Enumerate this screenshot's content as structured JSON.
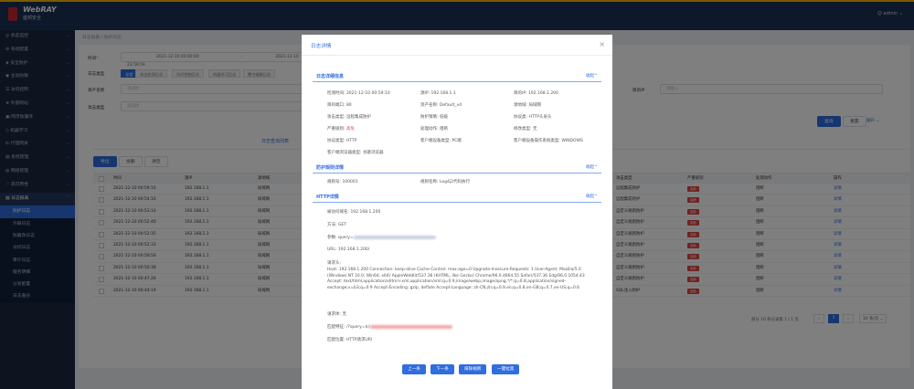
{
  "brand": {
    "name": "WebRAY",
    "sub": "盛邦安全"
  },
  "user": {
    "label": "admin"
  },
  "colors": {
    "accent": "#2f6de0",
    "danger": "#e0443e",
    "topbar": "#1b3157",
    "sidebar": "#1b2940"
  },
  "sidebar": {
    "items": [
      "状态监控",
      "系统配置",
      "安全防护",
      "主动防御",
      "访问控制",
      "外部网站",
      "网页防篡改",
      "机器学习",
      "代理网关",
      "系统管理",
      "网络管理",
      "高可用性",
      "日志报表"
    ],
    "sub": [
      "防护日志",
      "外联日志",
      "防篡改日志",
      "访问日志",
      "审计日志",
      "服务明细",
      "分发配置",
      "日志备份"
    ]
  },
  "breadcrumb": {
    "a": "日志报表",
    "sep": "/",
    "b": "防护日志"
  },
  "filters": {
    "time_label": "时间",
    "time_req": "*",
    "start": "2021-12-10 00:00:00",
    "to": "-",
    "end": "2021-12-10 23:59:59",
    "type_label": "日志类型",
    "chips": [
      "全部",
      "攻击检测日志",
      "访问控制日志",
      "机器学习日志",
      "暴力破解日志"
    ],
    "site_label": "资产名称",
    "site_ph": "请选择",
    "attack_label": "攻击类型",
    "attack_ph": "请选择",
    "ip_label": "目的IP",
    "ip_ph": "请输入",
    "query": "查询",
    "reset": "重置",
    "expand": "展开"
  },
  "table": {
    "tab": "日志查询列表",
    "actions": [
      "导出",
      "批删",
      "清空"
    ],
    "headers": [
      "时间",
      "源IP",
      "源地域",
      "攻击类型",
      "严重级别",
      "处理动作",
      "操作"
    ],
    "rows": [
      {
        "time": "2021-12-10 00:59:10",
        "ip": "192.168.1.1",
        "region": "局域网",
        "type": "远程集成防护",
        "sev": "高危",
        "act": "阻断",
        "op": "详情"
      },
      {
        "time": "2021-12-10 00:54:10",
        "ip": "192.168.1.1",
        "region": "局域网",
        "type": "远程集成防护",
        "sev": "高危",
        "act": "阻断",
        "op": "详情"
      },
      {
        "time": "2021-12-10 00:53:10",
        "ip": "192.168.1.1",
        "region": "局域网",
        "type": "自定义规则防护",
        "sev": "高危",
        "act": "阻断",
        "op": "详情"
      },
      {
        "time": "2021-12-10 00:52:40",
        "ip": "192.168.1.1",
        "region": "局域网",
        "type": "自定义规则防护",
        "sev": "高危",
        "act": "阻断",
        "op": "详情"
      },
      {
        "time": "2021-12-10 00:52:35",
        "ip": "192.168.1.1",
        "region": "局域网",
        "type": "自定义规则防护",
        "sev": "高危",
        "act": "阻断",
        "op": "详情"
      },
      {
        "time": "2021-12-10 00:52:33",
        "ip": "192.168.1.1",
        "region": "局域网",
        "type": "自定义规则防护",
        "sev": "高危",
        "act": "阻断",
        "op": "详情"
      },
      {
        "time": "2021-12-10 00:50:50",
        "ip": "192.168.1.1",
        "region": "局域网",
        "type": "自定义规则防护",
        "sev": "高危",
        "act": "阻断",
        "op": "详情"
      },
      {
        "time": "2021-12-10 00:50:38",
        "ip": "192.168.1.1",
        "region": "局域网",
        "type": "自定义规则防护",
        "sev": "高危",
        "act": "阻断",
        "op": "详情"
      },
      {
        "time": "2021-12-10 00:47:26",
        "ip": "192.168.1.1",
        "region": "局域网",
        "type": "自定义规则防护",
        "sev": "高危",
        "act": "阻断",
        "op": "详情"
      },
      {
        "time": "2021-12-10 00:44:19",
        "ip": "192.168.1.1",
        "region": "局域网",
        "type": "SQL注入防护",
        "sev": "高危",
        "act": "阻断",
        "op": "详情"
      }
    ],
    "pager": {
      "summary": "部分 10 条记录第 1 / 1 页",
      "page": "1",
      "size": "10 条/页"
    }
  },
  "modal": {
    "title": "日志详情",
    "collapse": "收起",
    "sec1": "日志详细信息",
    "f": {
      "time": "检测时间: 2021-12-10 00:59:10",
      "srcip": "源IP: 192.168.1.1",
      "dstip": "目的IP: 192.168.1.200",
      "dstport": "目的端口: 80",
      "asset": "资产名称: Default_v4",
      "region": "源地域: 局域网",
      "atype": "攻击类型: 远程集成防护",
      "chan": "防护策略: 低级",
      "proto": "协议类: HTTP头泉头",
      "sev_k": "严重级别:",
      "sev_v": "高危",
      "act": "处理动作: 阻断",
      "modtype": "修改类型: 无",
      "proto2": "协议类型: HTTP",
      "cli": "客户端设备类型: PC端",
      "os": "客户端设备操作系统类型: WINDOWS",
      "browser": "客户端浏览器类型: 谷歌浏览器"
    },
    "sec2": "防护规则详情",
    "rule_id": "规则号: 100001",
    "rule_name": "规则名称: Log4j2代码执行",
    "sec3": "HTTP详情",
    "host": "被访问域名: 192.168.1.200",
    "method": "方法: GET",
    "param_k": "参数:",
    "param_v": "query=",
    "url": "URL: 192.168.1.200/",
    "hdr_k": "请求头:",
    "hdr_v": "Host: 192.168.1.200 Connection: keep-alive Cache-Control: max-age=0 Upgrade-Insecure-Requests: 1 User-Agent: Mozilla/5.0 (Windows NT 10.0; Win64; x64) AppleWebKit/537.36 (KHTML, like Gecko) Chrome/96.0.4664.55 Safari/537.36 Edg/96.0.1054.43 Accept: text/html,application/xhtml+xml,application/xml;q=0.9,image/webp,image/apng,*/*;q=0.8,application/signed-exchange;v=b3;q=0.9 Accept-Encoding: gzip, deflate Accept-Language: zh-CN,zh;q=0.9,en;q=0.8,en-GB;q=0.7,en-US;q=0.6",
    "body": "请求体: 无",
    "match_k": "匹配特征:",
    "match_v": "/?query=${",
    "pos": "匹配位置: HTTP请求URI",
    "buttons": [
      "上一条",
      "下一条",
      "排除规则",
      "一键拉黑"
    ]
  }
}
